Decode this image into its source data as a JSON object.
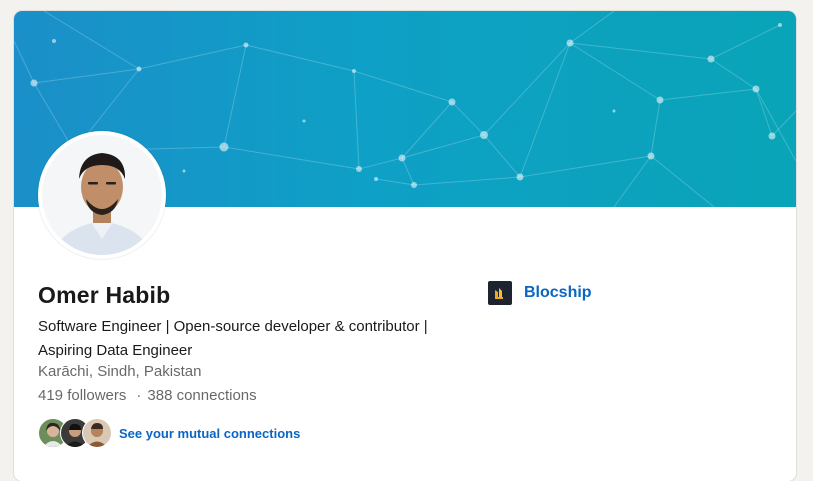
{
  "profile": {
    "name": "Omer Habib",
    "headline": "Software Engineer | Open-source developer & contributor | Aspiring Data Engineer",
    "location": "Karāchi, Sindh, Pakistan",
    "followers": "419 followers",
    "separator": "·",
    "connections": "388 connections",
    "mutual_label": "See your mutual connections"
  },
  "company": {
    "name": "Blocship",
    "logo_icon": "blocship-logo"
  },
  "colors": {
    "link": "#0a66c2",
    "banner_start": "#1b8fc9",
    "banner_end": "#0aa4b8"
  }
}
